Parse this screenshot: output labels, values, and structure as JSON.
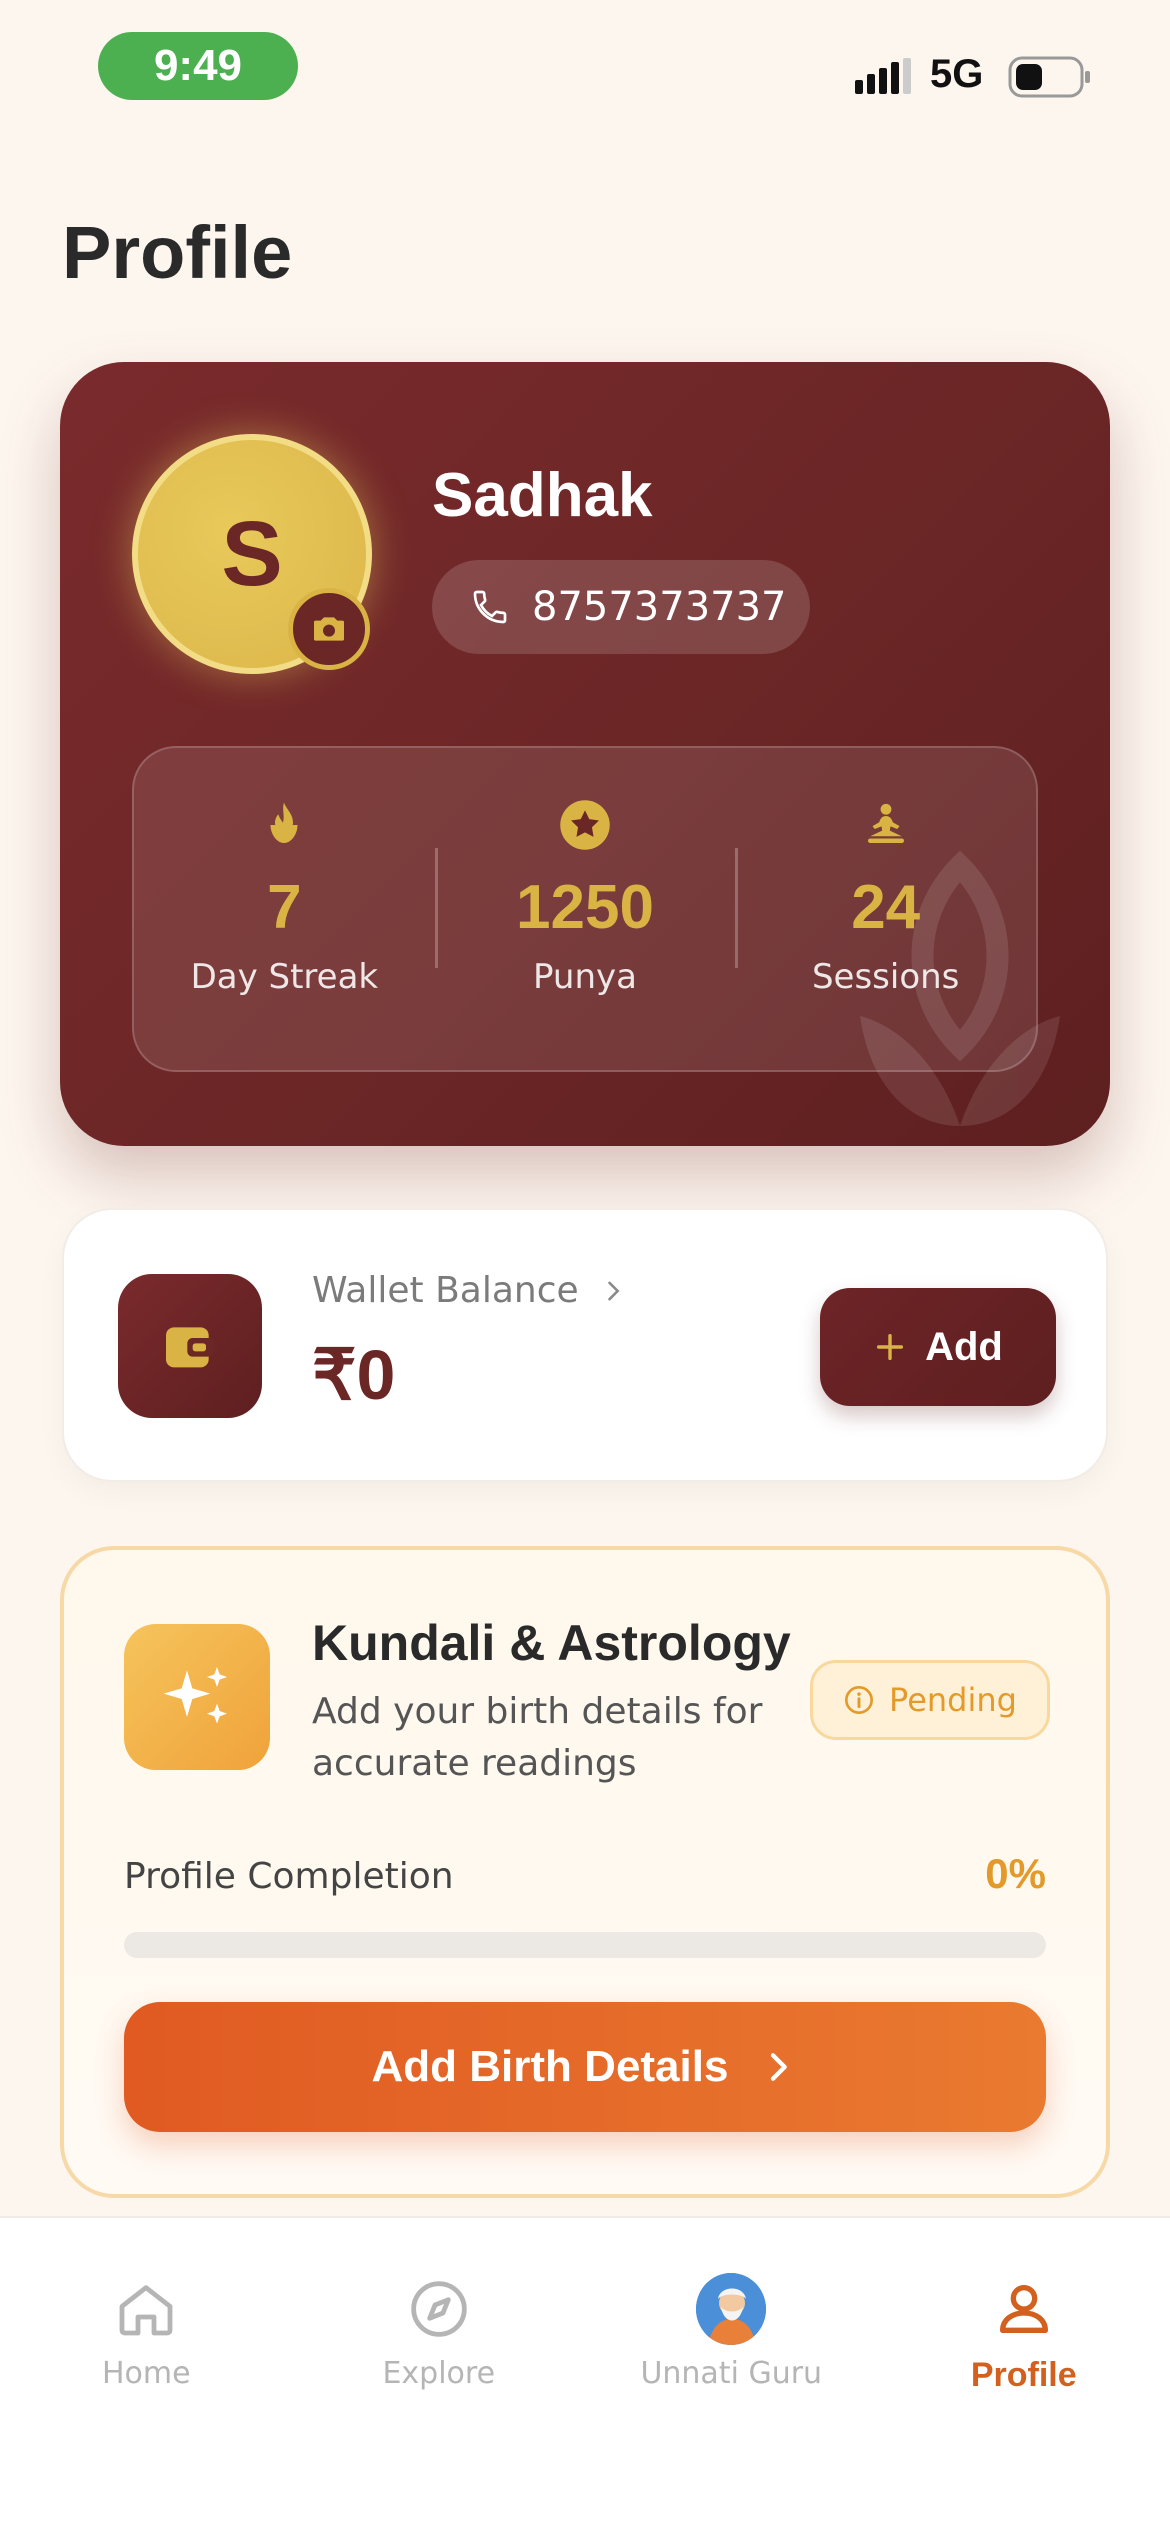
{
  "status_bar": {
    "time": "9:49",
    "network": "5G"
  },
  "page": {
    "title": "Profile"
  },
  "profile": {
    "initial": "S",
    "name": "Sadhak",
    "phone": "8757373737",
    "stats": [
      {
        "icon": "flame-icon",
        "value": "7",
        "label": "Day Streak"
      },
      {
        "icon": "star-icon",
        "value": "1250",
        "label": "Punya"
      },
      {
        "icon": "meditation-icon",
        "value": "24",
        "label": "Sessions"
      }
    ]
  },
  "wallet": {
    "label": "Wallet Balance",
    "amount": "₹0",
    "add_label": "Add"
  },
  "kundali": {
    "title": "Kundali & Astrology",
    "subtitle": "Add your birth details for accurate readings",
    "status": "Pending",
    "completion_label": "Profile Completion",
    "completion_value": "0%",
    "completion_fraction": 0,
    "button_label": "Add Birth Details"
  },
  "nav": {
    "items": [
      {
        "label": "Home",
        "icon": "home-icon",
        "active": false
      },
      {
        "label": "Explore",
        "icon": "compass-icon",
        "active": false
      },
      {
        "label": "Unnati Guru",
        "icon": "guru-avatar",
        "active": false
      },
      {
        "label": "Profile",
        "icon": "user-icon",
        "active": true
      }
    ]
  },
  "colors": {
    "maroon": "#6b2626",
    "gold": "#d9b444",
    "orange": "#e05a22",
    "amber": "#e39a2a",
    "status_green": "#4caf50"
  }
}
